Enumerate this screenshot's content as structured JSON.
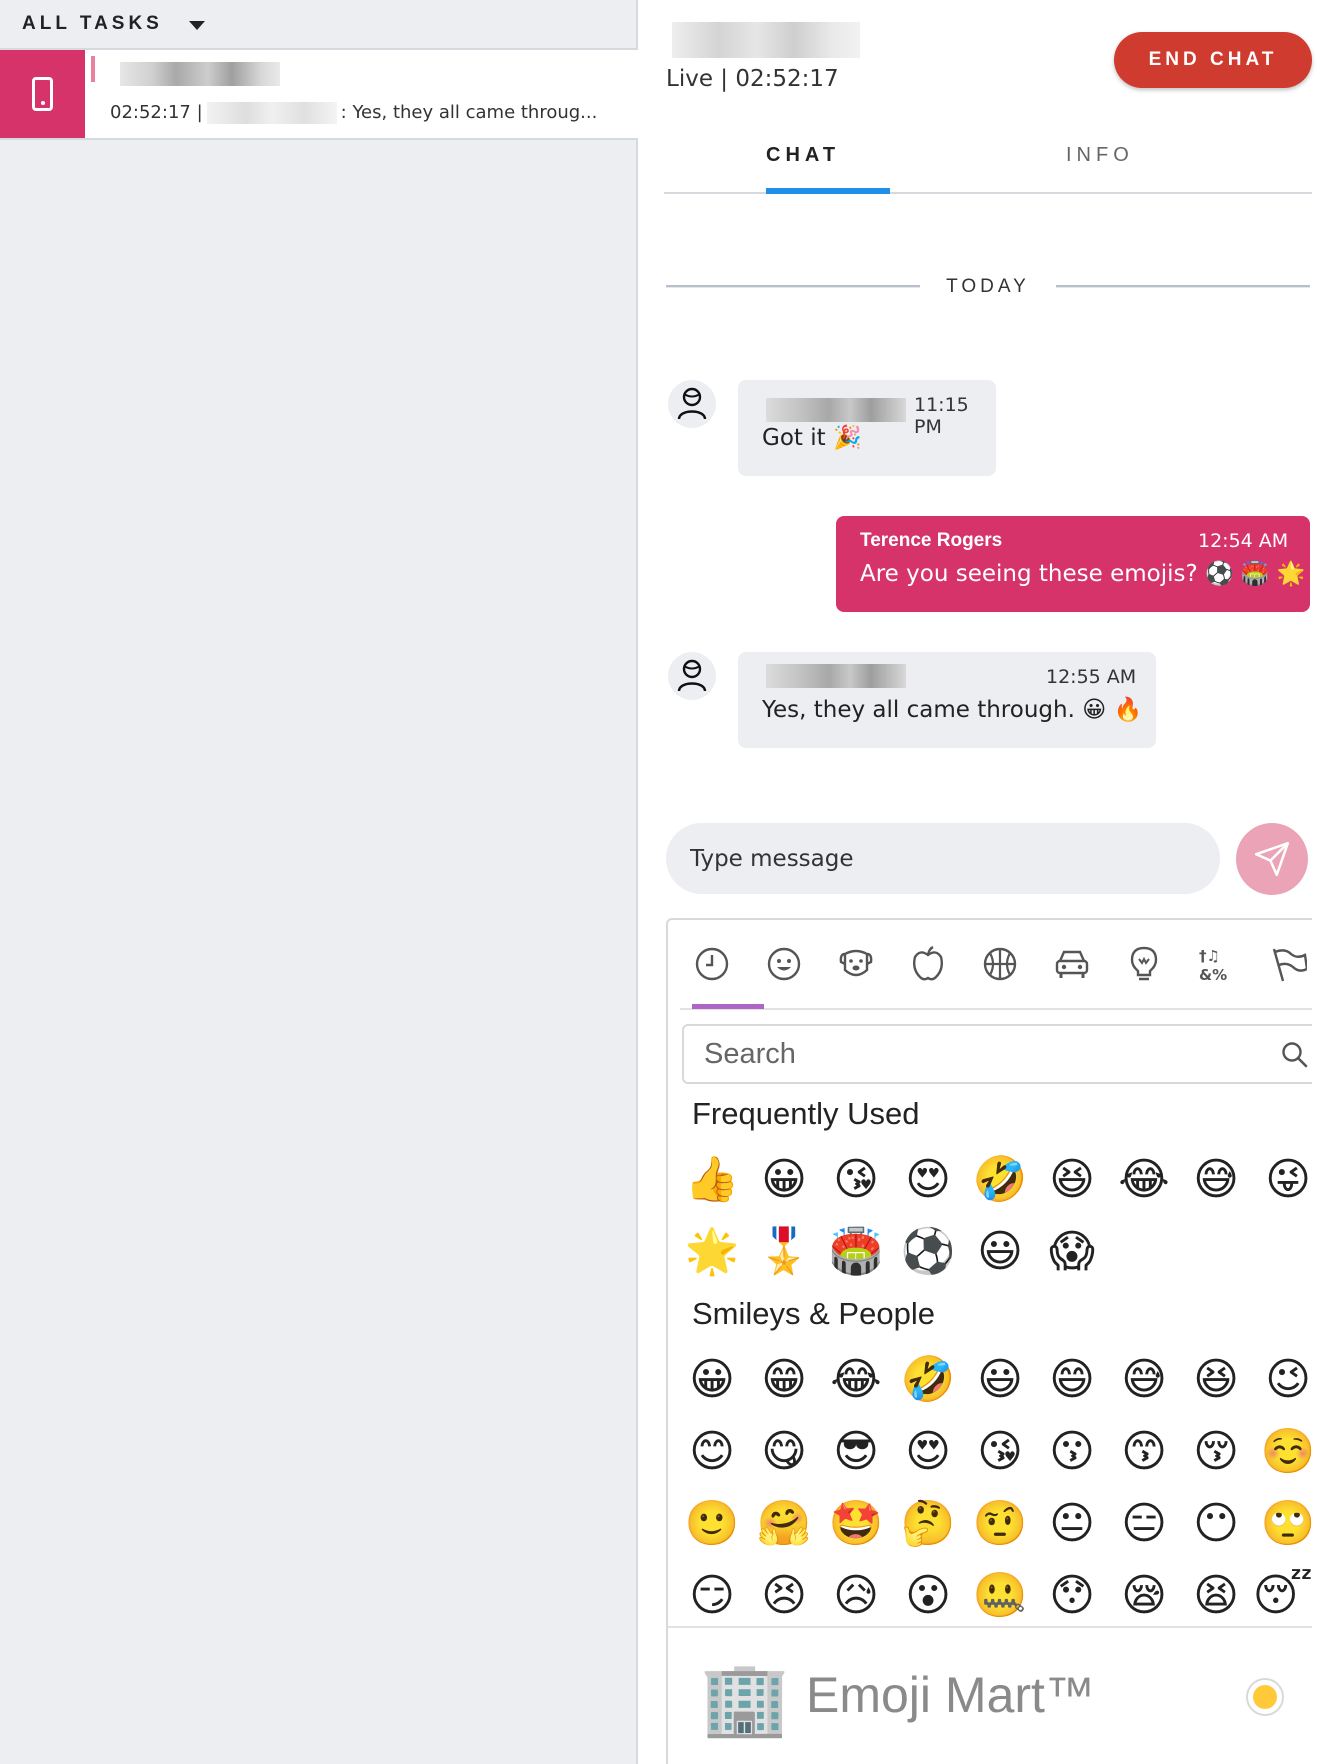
{
  "sidebar": {
    "header_title": "ALL TASKS",
    "task": {
      "time": "02:52:17",
      "separator": "|",
      "preview": ": Yes, they all came throug..."
    }
  },
  "chat": {
    "status": "Live | 02:52:17",
    "end_chat_label": "END CHAT",
    "tabs": [
      "CHAT",
      "INFO"
    ],
    "active_tab": "CHAT",
    "day_divider": "TODAY",
    "messages": [
      {
        "direction": "incoming",
        "time": "11:15 PM",
        "text": "Got it 🎉"
      },
      {
        "direction": "outgoing",
        "sender": "Terence Rogers",
        "time": "12:54 AM",
        "text": "Are you seeing these emojis? ⚽ 🏟️ 🌟"
      },
      {
        "direction": "incoming",
        "time": "12:55 AM",
        "text": "Yes, they all came through. 😀 🔥"
      }
    ],
    "input_placeholder": "Type message"
  },
  "emoji_picker": {
    "categories": [
      "recent-icon",
      "smiley-icon",
      "animal-icon",
      "food-icon",
      "activity-icon",
      "travel-icon",
      "objects-icon",
      "symbols-icon",
      "flags-icon"
    ],
    "active_category": "recent-icon",
    "search_placeholder": "Search",
    "sections": [
      {
        "title": "Frequently Used",
        "emojis": [
          "👍",
          "😀",
          "😘",
          "😍",
          "🤣",
          "😆",
          "😂",
          "😅",
          "😜",
          "🌟",
          "🎖️",
          "🏟️",
          "⚽",
          "😃",
          "😱"
        ]
      },
      {
        "title": "Smileys & People",
        "emojis": [
          "😀",
          "😁",
          "😂",
          "🤣",
          "😃",
          "😄",
          "😅",
          "😆",
          "😉",
          "😊",
          "😋",
          "😎",
          "😍",
          "😘",
          "😗",
          "😙",
          "😚",
          "☺️",
          "🙂",
          "🤗",
          "🤩",
          "🤔",
          "🤨",
          "😐",
          "😑",
          "😶",
          "🙄",
          "😏",
          "😣",
          "😥",
          "😮",
          "🤐",
          "😯",
          "😪",
          "😫",
          "😴"
        ]
      }
    ],
    "footer_title": "Emoji Mart™",
    "footer_emoji": "🏢",
    "skin_tone_color": "#ffc93a"
  },
  "colors": {
    "accent": "#d6336a",
    "end_chat": "#d03b2f",
    "tab_underline": "#1f8fe8",
    "picker_underline": "#ae65c5"
  }
}
